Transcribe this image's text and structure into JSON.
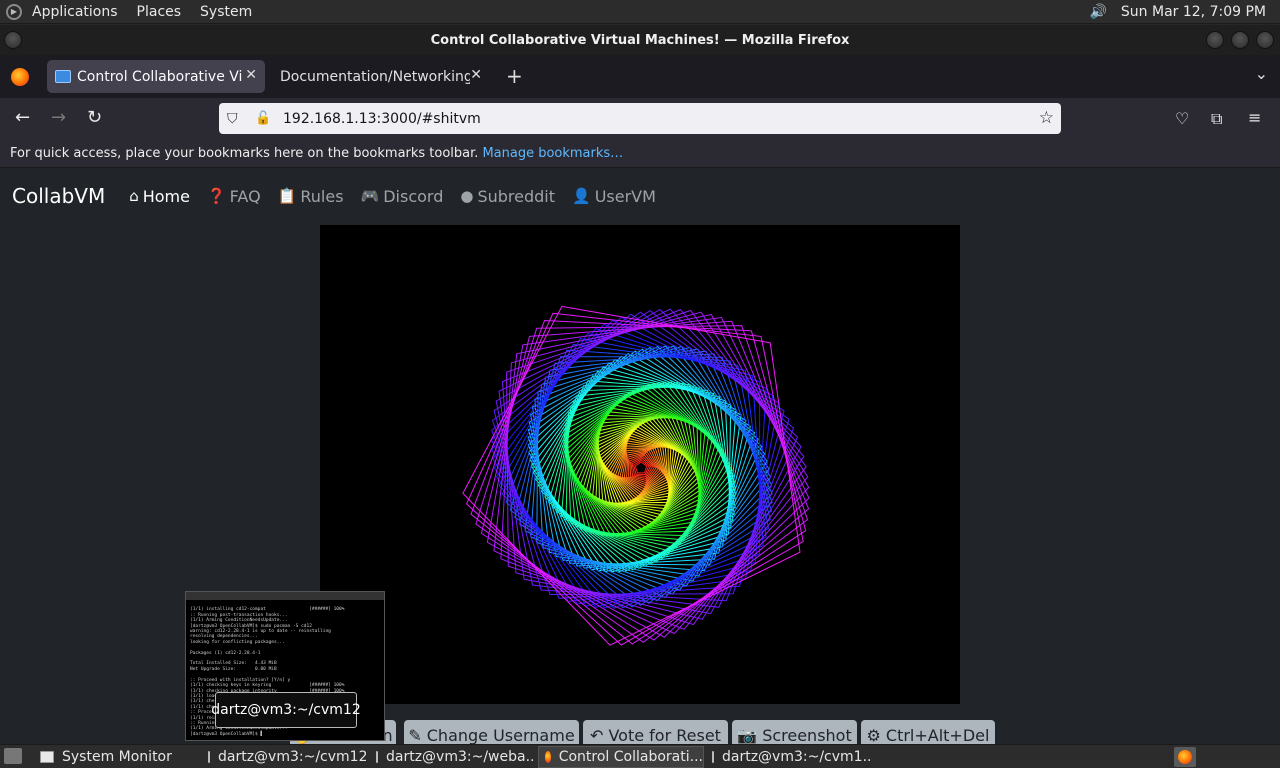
{
  "top_panel": {
    "menus": [
      "Applications",
      "Places",
      "System"
    ],
    "clock": "Sun Mar 12,  7:09 PM"
  },
  "window": {
    "title": "Control Collaborative Virtual Machines! — Mozilla Firefox"
  },
  "tabs": [
    {
      "label": "Control Collaborative Virtual Machines!",
      "active": true
    },
    {
      "label": "Documentation/Networking - QEMU",
      "active": false
    }
  ],
  "urlbar": {
    "url": "192.168.1.13:3000/#shitvm"
  },
  "bookmarks_bar": {
    "hint": "For quick access, place your bookmarks here on the bookmarks toolbar.",
    "manage_link": "Manage bookmarks…"
  },
  "site": {
    "brand": "CollabVM",
    "nav": [
      {
        "label": "Home",
        "icon": "home-icon",
        "active": true
      },
      {
        "label": "FAQ",
        "icon": "question-circle-icon",
        "active": false
      },
      {
        "label": "Rules",
        "icon": "clipboard-check-icon",
        "active": false
      },
      {
        "label": "Discord",
        "icon": "discord-icon",
        "active": false
      },
      {
        "label": "Subreddit",
        "icon": "reddit-icon",
        "active": false
      },
      {
        "label": "UserVM",
        "icon": "user-icon",
        "active": false
      }
    ],
    "vm_buttons": [
      {
        "label": "Take Turn",
        "icon": "hand-icon"
      },
      {
        "label": "Change Username",
        "icon": "user-edit-icon"
      },
      {
        "label": "Vote for Reset",
        "icon": "undo-icon"
      },
      {
        "label": "Screenshot",
        "icon": "camera-icon"
      },
      {
        "label": "Ctrl+Alt+Del",
        "icon": "gear-icon"
      }
    ]
  },
  "preview": {
    "tooltip": "dartz@vm3:~/cvm12"
  },
  "taskbar": [
    {
      "label": "System Monitor",
      "icon": "monitor-icon",
      "active": false
    },
    {
      "label": "dartz@vm3:~/cvm12",
      "icon": "terminal-icon",
      "active": false
    },
    {
      "label": "dartz@vm3:~/weba...",
      "icon": "terminal-icon",
      "active": false
    },
    {
      "label": "Control Collaborati...",
      "icon": "firefox-icon",
      "active": true
    },
    {
      "label": "dartz@vm3:~/cvm1...",
      "icon": "terminal-icon",
      "active": false
    }
  ],
  "colors": {
    "page_bg": "#212529",
    "vm_button_bg": "#adb5bd",
    "link": "#5fb8ff"
  }
}
